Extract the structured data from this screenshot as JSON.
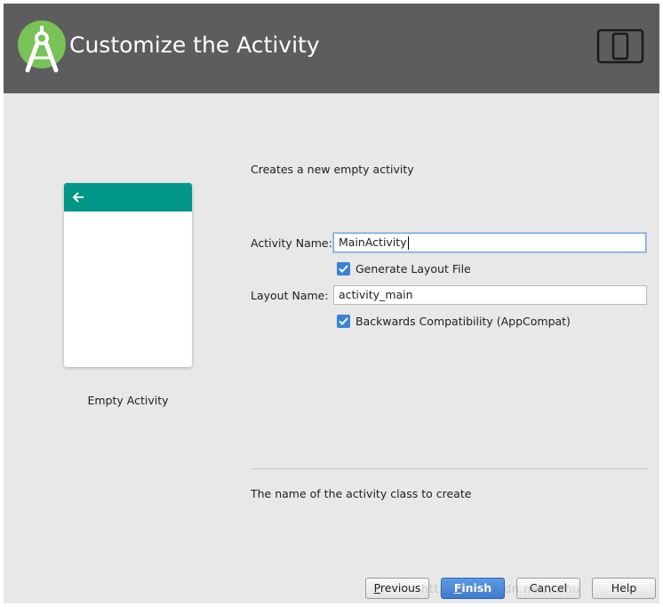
{
  "header": {
    "title": "Customize the Activity",
    "logo_icon": "android-studio-logo-icon",
    "device_icon": "tablet-phone-icon",
    "background": "#5d5d5d"
  },
  "preview": {
    "label": "Empty Activity",
    "appbar_color": "#009688",
    "back_icon": "arrow-back-icon"
  },
  "form": {
    "description": "Creates a new empty activity",
    "activity_name_label": "Activity Name:",
    "activity_name_value": "MainActivity",
    "generate_layout_label": "Generate Layout File",
    "generate_layout_checked": true,
    "layout_name_label": "Layout Name:",
    "layout_name_value": "activity_main",
    "backwards_compat_label": "Backwards Compatibility (AppCompat)",
    "backwards_compat_checked": true,
    "hint": "The name of the activity class to create"
  },
  "buttons": {
    "previous_mnemonic": "P",
    "previous_rest": "revious",
    "finish_mnemonic": "F",
    "finish_rest": "inish",
    "cancel": "Cancel",
    "help": "Help"
  },
  "watermark": "http://blog.csdn.net/.../hu",
  "colors": {
    "accent": "#3b82d6",
    "primary_button": "#3b7ad0"
  }
}
